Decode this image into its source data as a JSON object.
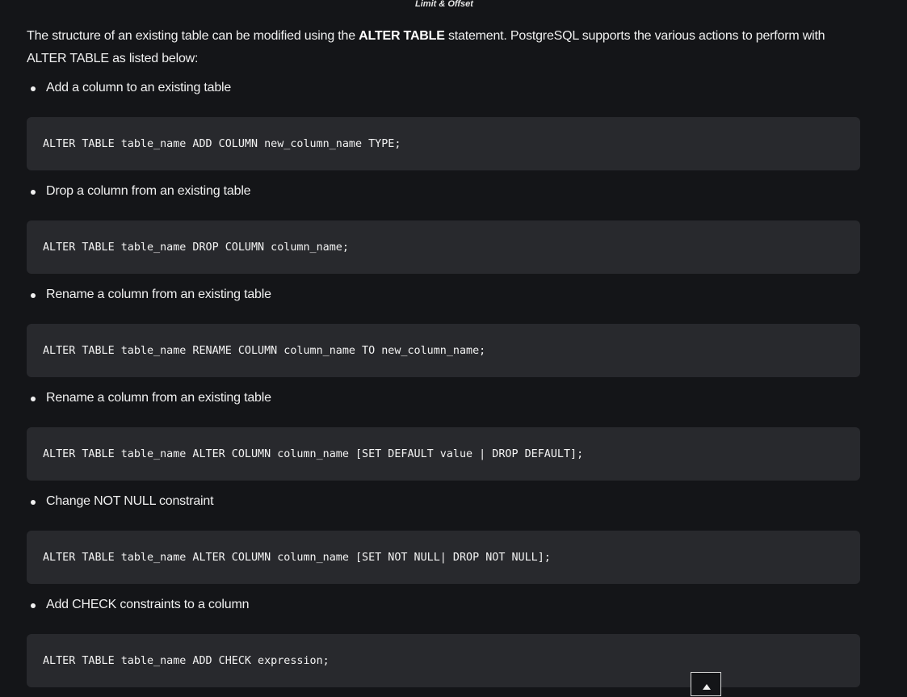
{
  "header": {
    "caption": "Limit & Offset"
  },
  "intro": {
    "text_before": "The structure of an existing table can be modified using the ",
    "strong": "ALTER TABLE",
    "text_after": " statement. PostgreSQL supports the various actions to perform with ALTER TABLE as listed below:"
  },
  "items": [
    {
      "label": "Add a column to an existing table",
      "code": "ALTER TABLE table_name ADD COLUMN new_column_name TYPE;"
    },
    {
      "label": "Drop a column from an existing table",
      "code": "ALTER TABLE table_name DROP COLUMN column_name;"
    },
    {
      "label": "Rename a column from an existing table",
      "code": "ALTER TABLE table_name RENAME COLUMN column_name TO new_column_name;"
    },
    {
      "label": "Rename a column from an existing table",
      "code": "ALTER TABLE table_name ALTER COLUMN column_name [SET DEFAULT value | DROP DEFAULT];"
    },
    {
      "label": "Change NOT NULL constraint",
      "code": "ALTER TABLE table_name ALTER COLUMN column_name [SET NOT NULL| DROP NOT NULL];"
    },
    {
      "label": "Add CHECK constraints to a column",
      "code": "ALTER TABLE table_name ADD CHECK expression;"
    }
  ],
  "controls": {
    "scroll_top_icon": "arrow-up-icon"
  }
}
